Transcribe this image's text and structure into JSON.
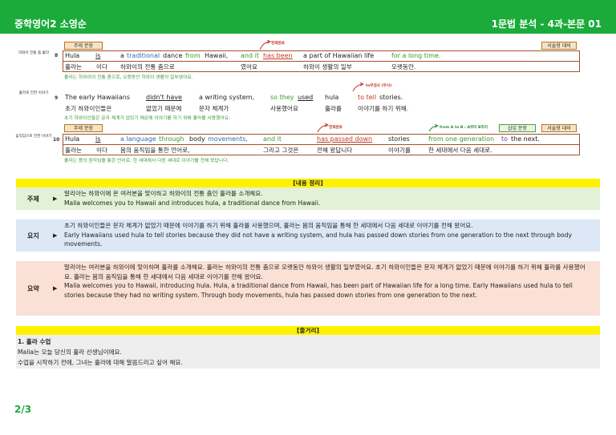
{
  "header": {
    "left": "중학영어2 소영순",
    "right": "1문법 분석 - 4과-본문 01"
  },
  "colors": {
    "brand_green": "#1aab3a",
    "highlight_yellow": "#fff200",
    "box_border": "#a0522d"
  },
  "tags": {
    "main_sentence": "주제 문장",
    "descriptive": "서술형 대비",
    "insert_sentence": "삽입 문장"
  },
  "s8": {
    "side": "하와이 전통 춤 훌라",
    "num": "8",
    "ann": "현재완료",
    "en": [
      "Hula",
      "is",
      "a",
      "traditional",
      "dance",
      "from",
      "Hawaii,",
      "and it",
      "has been",
      "a part of Hawaiian life",
      "for a long time."
    ],
    "ko": [
      "훌라는",
      "이다",
      "하와이의 전통 춤으로",
      "였어요",
      "하와이 생활의 일부",
      "오랫동안."
    ],
    "note": "훌라는 하와이의 전통 춤으로, 오랫동안 하와이 생활의 일부였어요."
  },
  "s9": {
    "side": "훌라로 전한 이야기",
    "num": "9",
    "ann": "to부정사 (부사)",
    "en": [
      "The early Hawaiians",
      "didn't have",
      "a writing system,",
      "so they",
      "used",
      "hula",
      "to tell",
      "stories."
    ],
    "ko": [
      "초기 하와이인들은",
      "없었기 때문에",
      "문자 체계가",
      "사용했어요",
      "훌라를",
      "이야기를 하기 위해."
    ],
    "note": "초기 하와이인들은 문자 체계가 없었기 때문에 이야기를 하기 위해 훌라를 사용했어요."
  },
  "s10": {
    "side": "움직임으로 전한 이야기",
    "num": "10",
    "ann1": "현재완료",
    "ann2": "from A to B : A부터 B까지",
    "en": [
      "Hula",
      "is",
      "a language",
      "through",
      "body",
      "movements,",
      "and it",
      "has passed down",
      "stories",
      "from one generation",
      "to",
      "the next."
    ],
    "ko": [
      "훌라는",
      "이다",
      "몸의 움직임을 통한 언어로,",
      "그리고 그것은",
      "전해 왔답니다",
      "이야기를",
      "한 세대에서 다음 세대로."
    ],
    "note": "훌라는 몸의 움직임을 통한 언어로, 한 세대에서 다음 세대로 이야기를 전해 왔답니다."
  },
  "summary": {
    "title": "[내용 정리]",
    "topic": {
      "label": "주제",
      "ko": "말리아는 하와이에 온 여러분을 맞이하고 하와이의 전통 춤인 훌라를 소개해요.",
      "en": "Malia welcomes you to Hawaii and introduces hula, a traditional dance from Hawaii."
    },
    "gist": {
      "label": "요지",
      "ko": "초기 하와이인들은 문자 체계가 없었기 때문에 이야기를 하기 위해 훌라를 사용했으며, 훌라는 몸의 움직임을 통해 한 세대에서 다음 세대로 이야기를 전해 왔어요.",
      "en": "Early Hawaiians used hula to tell stories because they did not have a writing system, and hula has passed down stories from one generation to the next through body movements."
    },
    "abstract": {
      "label": "요약",
      "ko": "말리아는 여러분을 하와이에 맞이하며 훌라를 소개해요. 훌라는 하와이의 전통 춤으로 오랫동안 하와이 생활의 일부였어요. 초기 하와이인들은 문자 체계가 없었기 때문에 이야기를 하기 위해 훌라를 사용했어요. 훌라는 몸의 움직임을 통해 한 세대에서 다음 세대로 이야기를 전해 왔어요.",
      "en": "Malia welcomes you to Hawaii, introducing hula. Hula, a traditional dance from Hawaii, has been part of Hawaiian life for a long time. Early Hawaiians used hula to tell stories because they had no writing system. Through body movements, hula has passed down stories from one generation to the next."
    }
  },
  "plot": {
    "title": "[줄거리]",
    "heading": "1. 훌라 수업",
    "line1": "Malia는 오늘 당신의 훌라 선생님이에요.",
    "line2": "수업을 시작하기 전에, 그녀는 훌라에 대해 말씀드리고 싶어 해요."
  },
  "footer": {
    "page": "2/3"
  }
}
